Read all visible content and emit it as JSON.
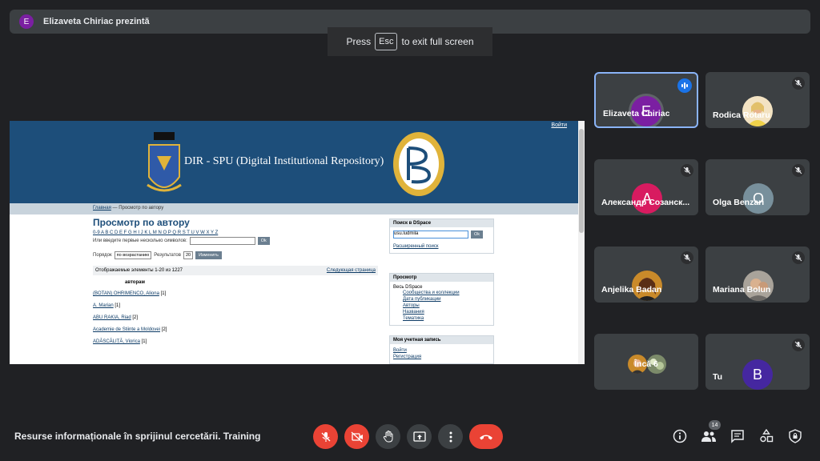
{
  "presenter": {
    "initial": "E",
    "text": "Elizaveta Chiriac prezintă"
  },
  "esc_toast": {
    "before": "Press",
    "key": "Esc",
    "after": "to exit full screen"
  },
  "shared": {
    "login": "Войти",
    "repo_title": "DIR - SPU (Digital Institutional Repository)",
    "breadcrumb_home": "Главная",
    "breadcrumb_sep": "—",
    "breadcrumb_current": "Просмотр по автору",
    "heading": "Просмотр по автору",
    "alphabet": "0-9 A B C D E F G H I J K L M N O P Q R S T U V W X Y Z",
    "first_letters_label": "Или введите первые несколько символов:",
    "ok": "Ok",
    "order_label": "Порядок",
    "order_value": "по возрастанию",
    "results_label": "Результатов",
    "results_value": "20",
    "change_button": "Изменить",
    "showing": "Отображаемые элементы 1-20 из 1227",
    "next_page": "Следующая страница",
    "column": "авторам",
    "items": [
      {
        "name": "(BOTAN) OHRIMENCO, Aliona",
        "count": "[1]"
      },
      {
        "name": "A. Marian",
        "count": "[1]"
      },
      {
        "name": "ABU RAKIA, Riad",
        "count": "[2]"
      },
      {
        "name": "Academie de Stiinte a Moldovei",
        "count": "[2]"
      },
      {
        "name": "ADĂSCĂLIȚĂ, Viorica",
        "count": "[1]"
      }
    ],
    "search_box": {
      "title": "Поиск в DSpace",
      "value": "usu.ludmila",
      "ok": "Ok",
      "advanced": "Расширенный поиск"
    },
    "browse_box": {
      "title": "Просмотр",
      "all": "Весь DSpace",
      "links": [
        "Сообщества и коллекции",
        "Дата публикации",
        "Авторы",
        "Названия",
        "Тематика"
      ]
    },
    "account_box": {
      "title": "Моя учетная запись",
      "links": [
        "Войти",
        "Регистрация"
      ]
    }
  },
  "participants": [
    {
      "name": "Elizaveta Chiriac",
      "initial": "E",
      "color": "#7b1fa2",
      "active": true
    },
    {
      "name": "Rodica Rotaru",
      "photo": true,
      "muted": true
    },
    {
      "name": "Александр Созанск...",
      "initial": "A",
      "color": "#d81b60",
      "muted": true
    },
    {
      "name": "Olga Benzari",
      "initial": "O",
      "color": "#78909c",
      "muted": true
    },
    {
      "name": "Anjelika Badan",
      "photo": true,
      "muted": true
    },
    {
      "name": "Mariana Bolun",
      "photo": true,
      "muted": true
    },
    {
      "name": "Încă 6"
    },
    {
      "name": "Tu",
      "initial": "B",
      "color": "#4527a0",
      "muted": true
    }
  ],
  "meeting_name": "Resurse informaționale în sprijinul cercetării. Training",
  "people_count": "14"
}
